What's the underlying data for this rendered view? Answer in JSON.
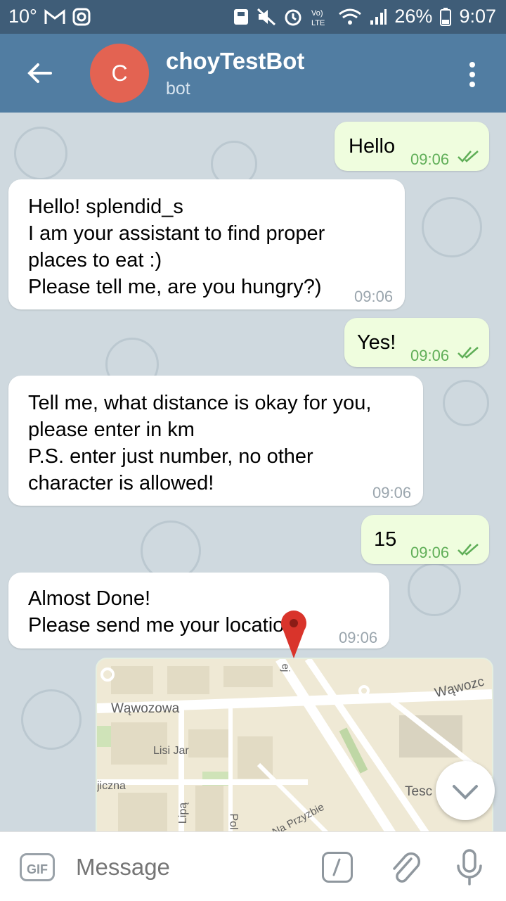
{
  "status_bar": {
    "temp": "10°",
    "battery": "26%",
    "clock": "9:07",
    "icons": [
      "gmail-icon",
      "instagram-icon",
      "save-icon",
      "mute-icon",
      "alarm-icon",
      "volte-icon",
      "wifi-icon",
      "signal-icon",
      "battery-icon"
    ]
  },
  "header": {
    "avatar_letter": "C",
    "title": "choyTestBot",
    "subtitle": "bot",
    "avatar_color": "#e36352",
    "bar_color": "#517da2"
  },
  "messages": [
    {
      "direction": "out",
      "text": "Hello",
      "time": "09:06"
    },
    {
      "direction": "in",
      "text": "Hello! splendid_s\nI am your assistant to find proper\nplaces to eat :)\nPlease tell me, are you hungry?)",
      "time": "09:06"
    },
    {
      "direction": "out",
      "text": "Yes!",
      "time": "09:06"
    },
    {
      "direction": "in",
      "text": "Tell me, what distance is okay for you,\nplease enter in km\nP.S. enter just number, no other\ncharacter is allowed!",
      "time": "09:06"
    },
    {
      "direction": "out",
      "text": "15",
      "time": "09:06"
    },
    {
      "direction": "in",
      "text": "Almost Done!\nPlease send me your location!",
      "time": "09:06"
    }
  ],
  "map": {
    "labels": [
      "Wąwozowa",
      "Wąwozc",
      "Lisi Jar",
      "jiczna",
      "Lipą",
      "Pol",
      "Na Przyzbie",
      "Tesc",
      "ej"
    ]
  },
  "input": {
    "gif_label": "GIF",
    "placeholder": "Message"
  }
}
